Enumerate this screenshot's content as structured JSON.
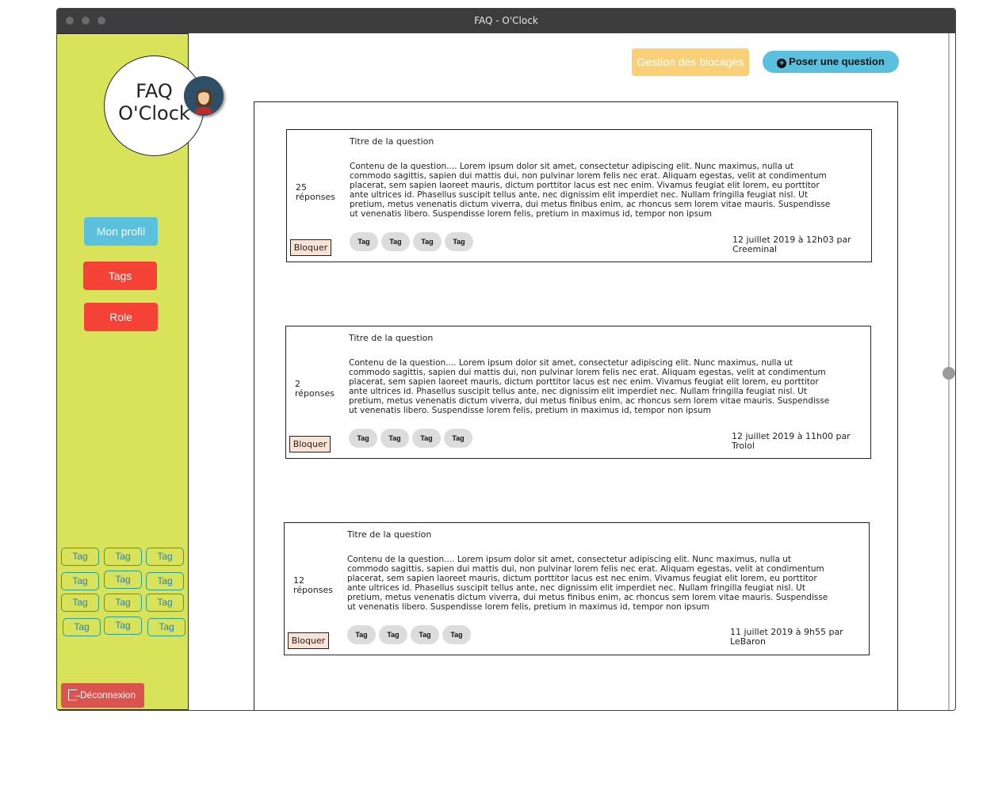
{
  "window": {
    "title": "FAQ - O'Clock"
  },
  "sidebar": {
    "logo_line1": "FAQ",
    "logo_line2": "O'Clock",
    "profil_label": "Mon profil",
    "tags_label": "Tags",
    "role_label": "Role",
    "tag_cloud": [
      "Tag",
      "Tag",
      "Tag",
      "Tag",
      "Tag",
      "Tag",
      "Tag",
      "Tag",
      "Tag",
      "Tag",
      "Tag",
      "Tag"
    ],
    "logout_label": "Déconnexion"
  },
  "header": {
    "blocages_label": "Gestion des blocages",
    "poser_label": "Poser une question"
  },
  "questions": [
    {
      "replies": "25 réponses",
      "title": "Titre de la question",
      "body": "Contenu de la question.... Lorem ipsum dolor sit amet, consectetur adipiscing elit. Nunc maximus, nulla ut commodo sagittis, sapien dui mattis dui, non pulvinar lorem felis nec erat. Aliquam egestas, velit at condimentum placerat, sem sapien laoreet mauris, dictum porttitor lacus est nec enim. Vivamus feugiat elit lorem, eu porttitor ante ultrices id. Phasellus suscipit tellus ante, nec dignissim elit imperdiet nec. Nullam fringilla feugiat nisl. Ut pretium, metus venenatis dictum viverra, dui metus finibus enim, ac rhoncus sem lorem vitae mauris. Suspendisse ut venenatis libero. Suspendisse lorem felis, pretium in maximus id, tempor non ipsum",
      "block_label": "Bloquer",
      "tags": [
        "Tag",
        "Tag",
        "Tag",
        "Tag"
      ],
      "meta": "12 juillet 2019 à 12h03 par Creeminal"
    },
    {
      "replies": "2 réponses",
      "title": "Titre de la question",
      "body": "Contenu de la question.... Lorem ipsum dolor sit amet, consectetur adipiscing elit. Nunc maximus, nulla ut commodo sagittis, sapien dui mattis dui, non pulvinar lorem felis nec erat. Aliquam egestas, velit at condimentum placerat, sem sapien laoreet mauris, dictum porttitor lacus est nec enim. Vivamus feugiat elit lorem, eu porttitor ante ultrices id. Phasellus suscipit tellus ante, nec dignissim elit imperdiet nec. Nullam fringilla feugiat nisl. Ut pretium, metus venenatis dictum viverra, dui metus finibus enim, ac rhoncus sem lorem vitae mauris. Suspendisse ut venenatis libero. Suspendisse lorem felis, pretium in maximus id, tempor non ipsum",
      "block_label": "Bloquer",
      "tags": [
        "Tag",
        "Tag",
        "Tag",
        "Tag"
      ],
      "meta": "12 juillet 2019 à 11h00 par Trolol"
    },
    {
      "replies": "12 réponses",
      "title": "Titre de la question",
      "body": "Contenu de la question.... Lorem ipsum dolor sit amet, consectetur adipiscing elit. Nunc maximus, nulla ut commodo sagittis, sapien dui mattis dui, non pulvinar lorem felis nec erat. Aliquam egestas, velit at condimentum placerat, sem sapien laoreet mauris, dictum porttitor lacus est nec enim. Vivamus feugiat elit lorem, eu porttitor ante ultrices id. Phasellus suscipit tellus ante, nec dignissim elit imperdiet nec. Nullam fringilla feugiat nisl. Ut pretium, metus venenatis dictum viverra, dui metus finibus enim, ac rhoncus sem lorem vitae mauris. Suspendisse ut venenatis libero. Suspendisse lorem felis, pretium in maximus id, tempor non ipsum",
      "block_label": "Bloquer",
      "tags": [
        "Tag",
        "Tag",
        "Tag",
        "Tag"
      ],
      "meta": "11 juillet 2019 à 9h55 par LeBaron"
    }
  ],
  "icons": {
    "avatar": "user-avatar-icon",
    "poser": "plus-circle-icon",
    "logout": "logout-icon"
  },
  "colors": {
    "sidebar_bg": "#d9e35a",
    "info": "#5bc0de",
    "danger": "#f44336",
    "warning": "#f9cf78"
  }
}
